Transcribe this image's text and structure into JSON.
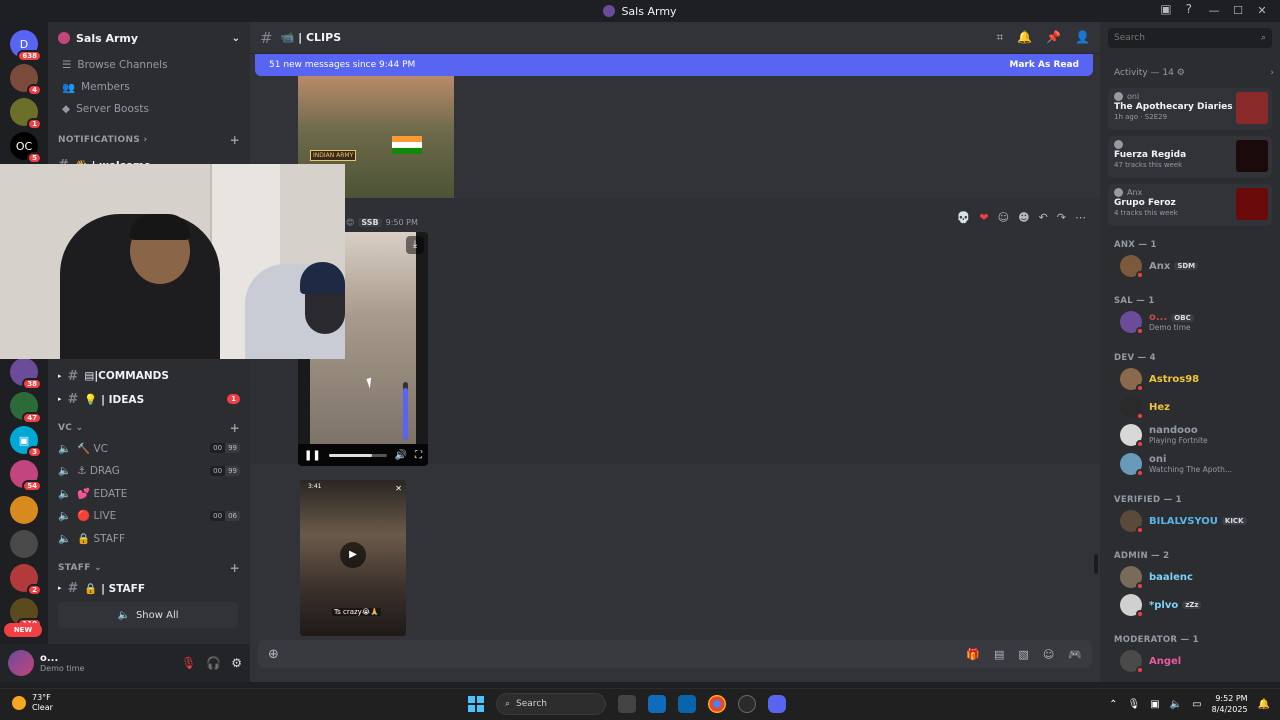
{
  "window": {
    "title": "Sals Army",
    "controls": [
      "—",
      "☐",
      "✕"
    ]
  },
  "guilds": [
    {
      "badge": "638",
      "color": "#5865f2",
      "glyph": "D"
    },
    {
      "badge": "4",
      "color": "#7a4a3a",
      "glyph": ""
    },
    {
      "badge": "1",
      "color": "#6b6f2a",
      "glyph": ""
    },
    {
      "badge": "5",
      "color": "#000000",
      "glyph": "OC"
    },
    {
      "badge": "38",
      "color": "#6b4c9a",
      "glyph": ""
    },
    {
      "badge": "47",
      "color": "#2d6a3a",
      "glyph": ""
    },
    {
      "badge": "3",
      "color": "#00a8d6",
      "glyph": "▣"
    },
    {
      "badge": "54",
      "color": "#c2457d",
      "glyph": ""
    },
    {
      "badge": "",
      "color": "#d88a1e",
      "glyph": ""
    },
    {
      "badge": "",
      "color": "#4a4a4a",
      "glyph": ""
    },
    {
      "badge": "2",
      "color": "#b23a3a",
      "glyph": ""
    },
    {
      "badge": "110",
      "color": "#5a4a1e",
      "glyph": ""
    }
  ],
  "new_pill": "NEW",
  "server": {
    "name": "Sals Army",
    "nav": [
      "Browse Channels",
      "Members",
      "Server Boosts"
    ],
    "notifications_cat": "NOTIFICATIONS",
    "welcome": "👋 | welcome",
    "commands": "▤|COMMANDS",
    "ideas": "💡 | IDEAS",
    "ideas_badge": "1",
    "vc_cat": "VC",
    "voice": [
      {
        "name": "🔨 VC",
        "a": "00",
        "b": "99"
      },
      {
        "name": "⚓ DRAG",
        "a": "00",
        "b": "99"
      },
      {
        "name": "💕 EDATE",
        "a": "",
        "b": ""
      },
      {
        "name": "🔴 LIVE",
        "a": "00",
        "b": "06"
      },
      {
        "name": "🔒 STAFF",
        "a": "",
        "b": ""
      }
    ],
    "staff_cat": "STAFF",
    "staff_chan": "🔒 | STAFF",
    "show_all": "Show All"
  },
  "user_panel": {
    "name": "o...",
    "status": "Demo time"
  },
  "channel": {
    "name": "📹 | CLIPS",
    "new_messages": "51 new messages since 9:44 PM",
    "mark_read": "Mark As Read",
    "msg_tag": "SSB",
    "msg_time": "9:50 PM",
    "patch": "INDIAN ARMY",
    "clip_time": "3:41",
    "clip_caption": "Ts crazy😭🙏",
    "composer_placeholder": ""
  },
  "search": {
    "placeholder": "Search"
  },
  "activity": {
    "header": "Activity — 14",
    "cards": [
      {
        "user": "oni",
        "title": "The Apothecary Diaries",
        "meta": "1h ago · S2E29",
        "thumb": "#8a2a2a"
      },
      {
        "user": "",
        "title": "Fuerza Regida",
        "meta": "47 tracks this week",
        "thumb": "#1a0a0a"
      },
      {
        "user": "Anx",
        "title": "Grupo Feroz",
        "meta": "4 tracks this week",
        "thumb": "#6a0a0a"
      }
    ]
  },
  "member_groups": [
    {
      "label": "ANX — 1",
      "members": [
        {
          "name": "Anx",
          "color": "#949ba4",
          "tag": "SDM",
          "sub": ""
        }
      ]
    },
    {
      "label": "SAL — 1",
      "members": [
        {
          "name": "o...",
          "color": "#c94a4a",
          "tag": "OBC",
          "sub": "Demo time"
        }
      ]
    },
    {
      "label": "DEV — 4",
      "members": [
        {
          "name": "Astros98",
          "color": "#f0c53a",
          "tag": "",
          "sub": ""
        },
        {
          "name": "Hez",
          "color": "#f0c53a",
          "tag": "",
          "sub": ""
        },
        {
          "name": "nandooo",
          "color": "#949ba4",
          "tag": "",
          "sub": "Playing Fortnite"
        },
        {
          "name": "oni",
          "color": "#949ba4",
          "tag": "",
          "sub": "Watching The Apoth..."
        }
      ]
    },
    {
      "label": "VERIFIED — 1",
      "members": [
        {
          "name": "BILALVSYOU",
          "color": "#5ab6e8",
          "tag": "KICK",
          "sub": ""
        }
      ]
    },
    {
      "label": "ADMIN — 2",
      "members": [
        {
          "name": "baalenc",
          "color": "#7bd3f7",
          "tag": "",
          "sub": ""
        },
        {
          "name": "*plvo",
          "color": "#7bd3f7",
          "tag": "zZz",
          "sub": ""
        }
      ]
    },
    {
      "label": "MODERATOR — 1",
      "members": [
        {
          "name": "Angel",
          "color": "#e85aa0",
          "tag": "",
          "sub": ""
        }
      ]
    }
  ],
  "taskbar": {
    "temp": "73°F",
    "weather": "Clear",
    "search": "Search",
    "time": "9:52 PM",
    "date": "8/4/2025"
  }
}
